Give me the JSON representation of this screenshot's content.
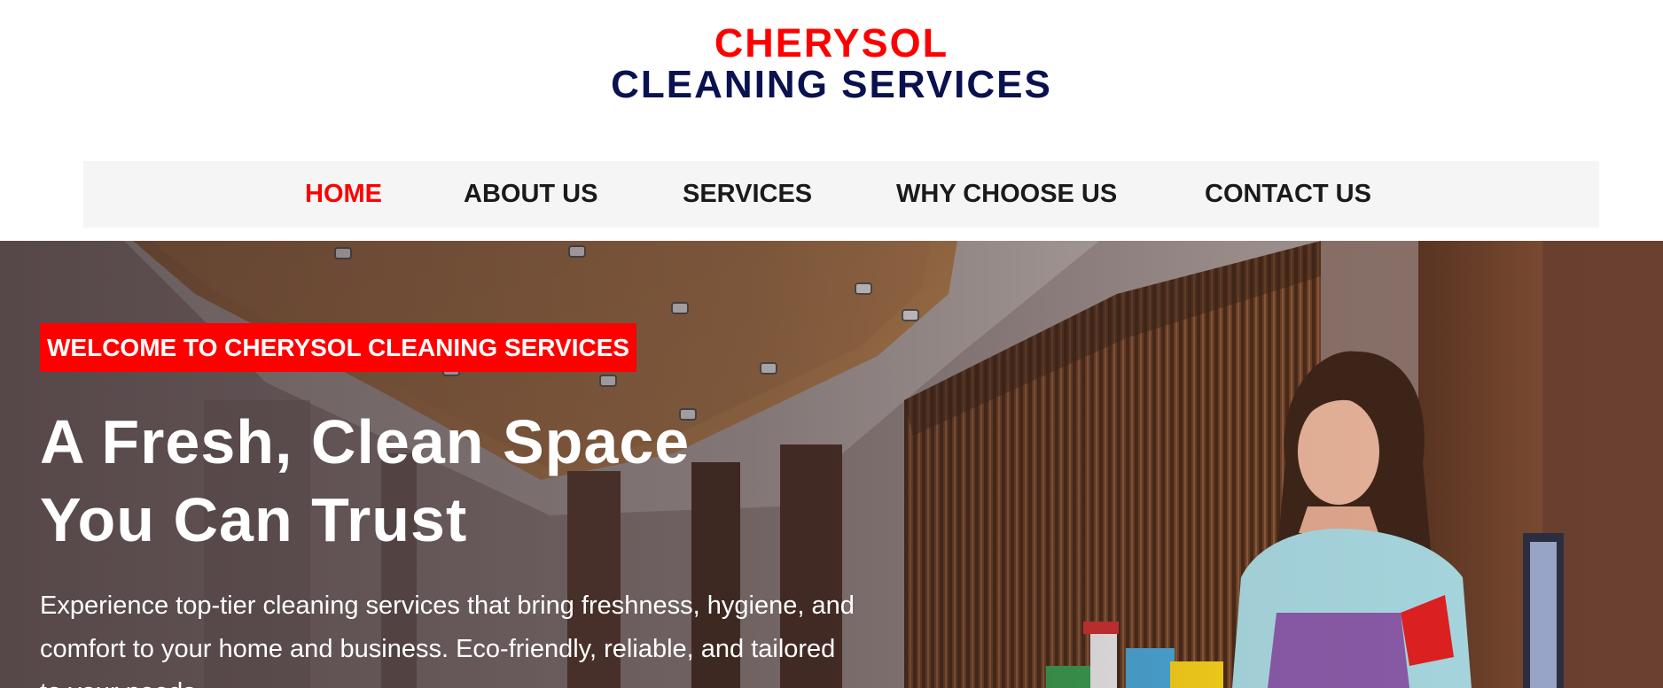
{
  "brand": {
    "line1": "CHERYSOL",
    "line2": "CLEANING SERVICES",
    "primary_color": "#ff0000",
    "secondary_color": "#0a1150"
  },
  "nav": {
    "items": [
      {
        "label": "HOME",
        "active": true
      },
      {
        "label": "ABOUT US",
        "active": false
      },
      {
        "label": "SERVICES",
        "active": false
      },
      {
        "label": "WHY CHOOSE US",
        "active": false
      },
      {
        "label": "CONTACT US",
        "active": false
      }
    ]
  },
  "hero": {
    "badge": "WELCOME TO CHERYSOL CLEANING SERVICES",
    "title_line1": "A Fresh, Clean Space",
    "title_line2": "You Can Trust",
    "description": "Experience top-tier cleaning services that bring freshness, hygiene, and comfort to your home and business. Eco-friendly, reliable, and tailored to your needs.",
    "image": "hotel-lobby-photo-with-smiling-cleaner-holding-supplies"
  }
}
